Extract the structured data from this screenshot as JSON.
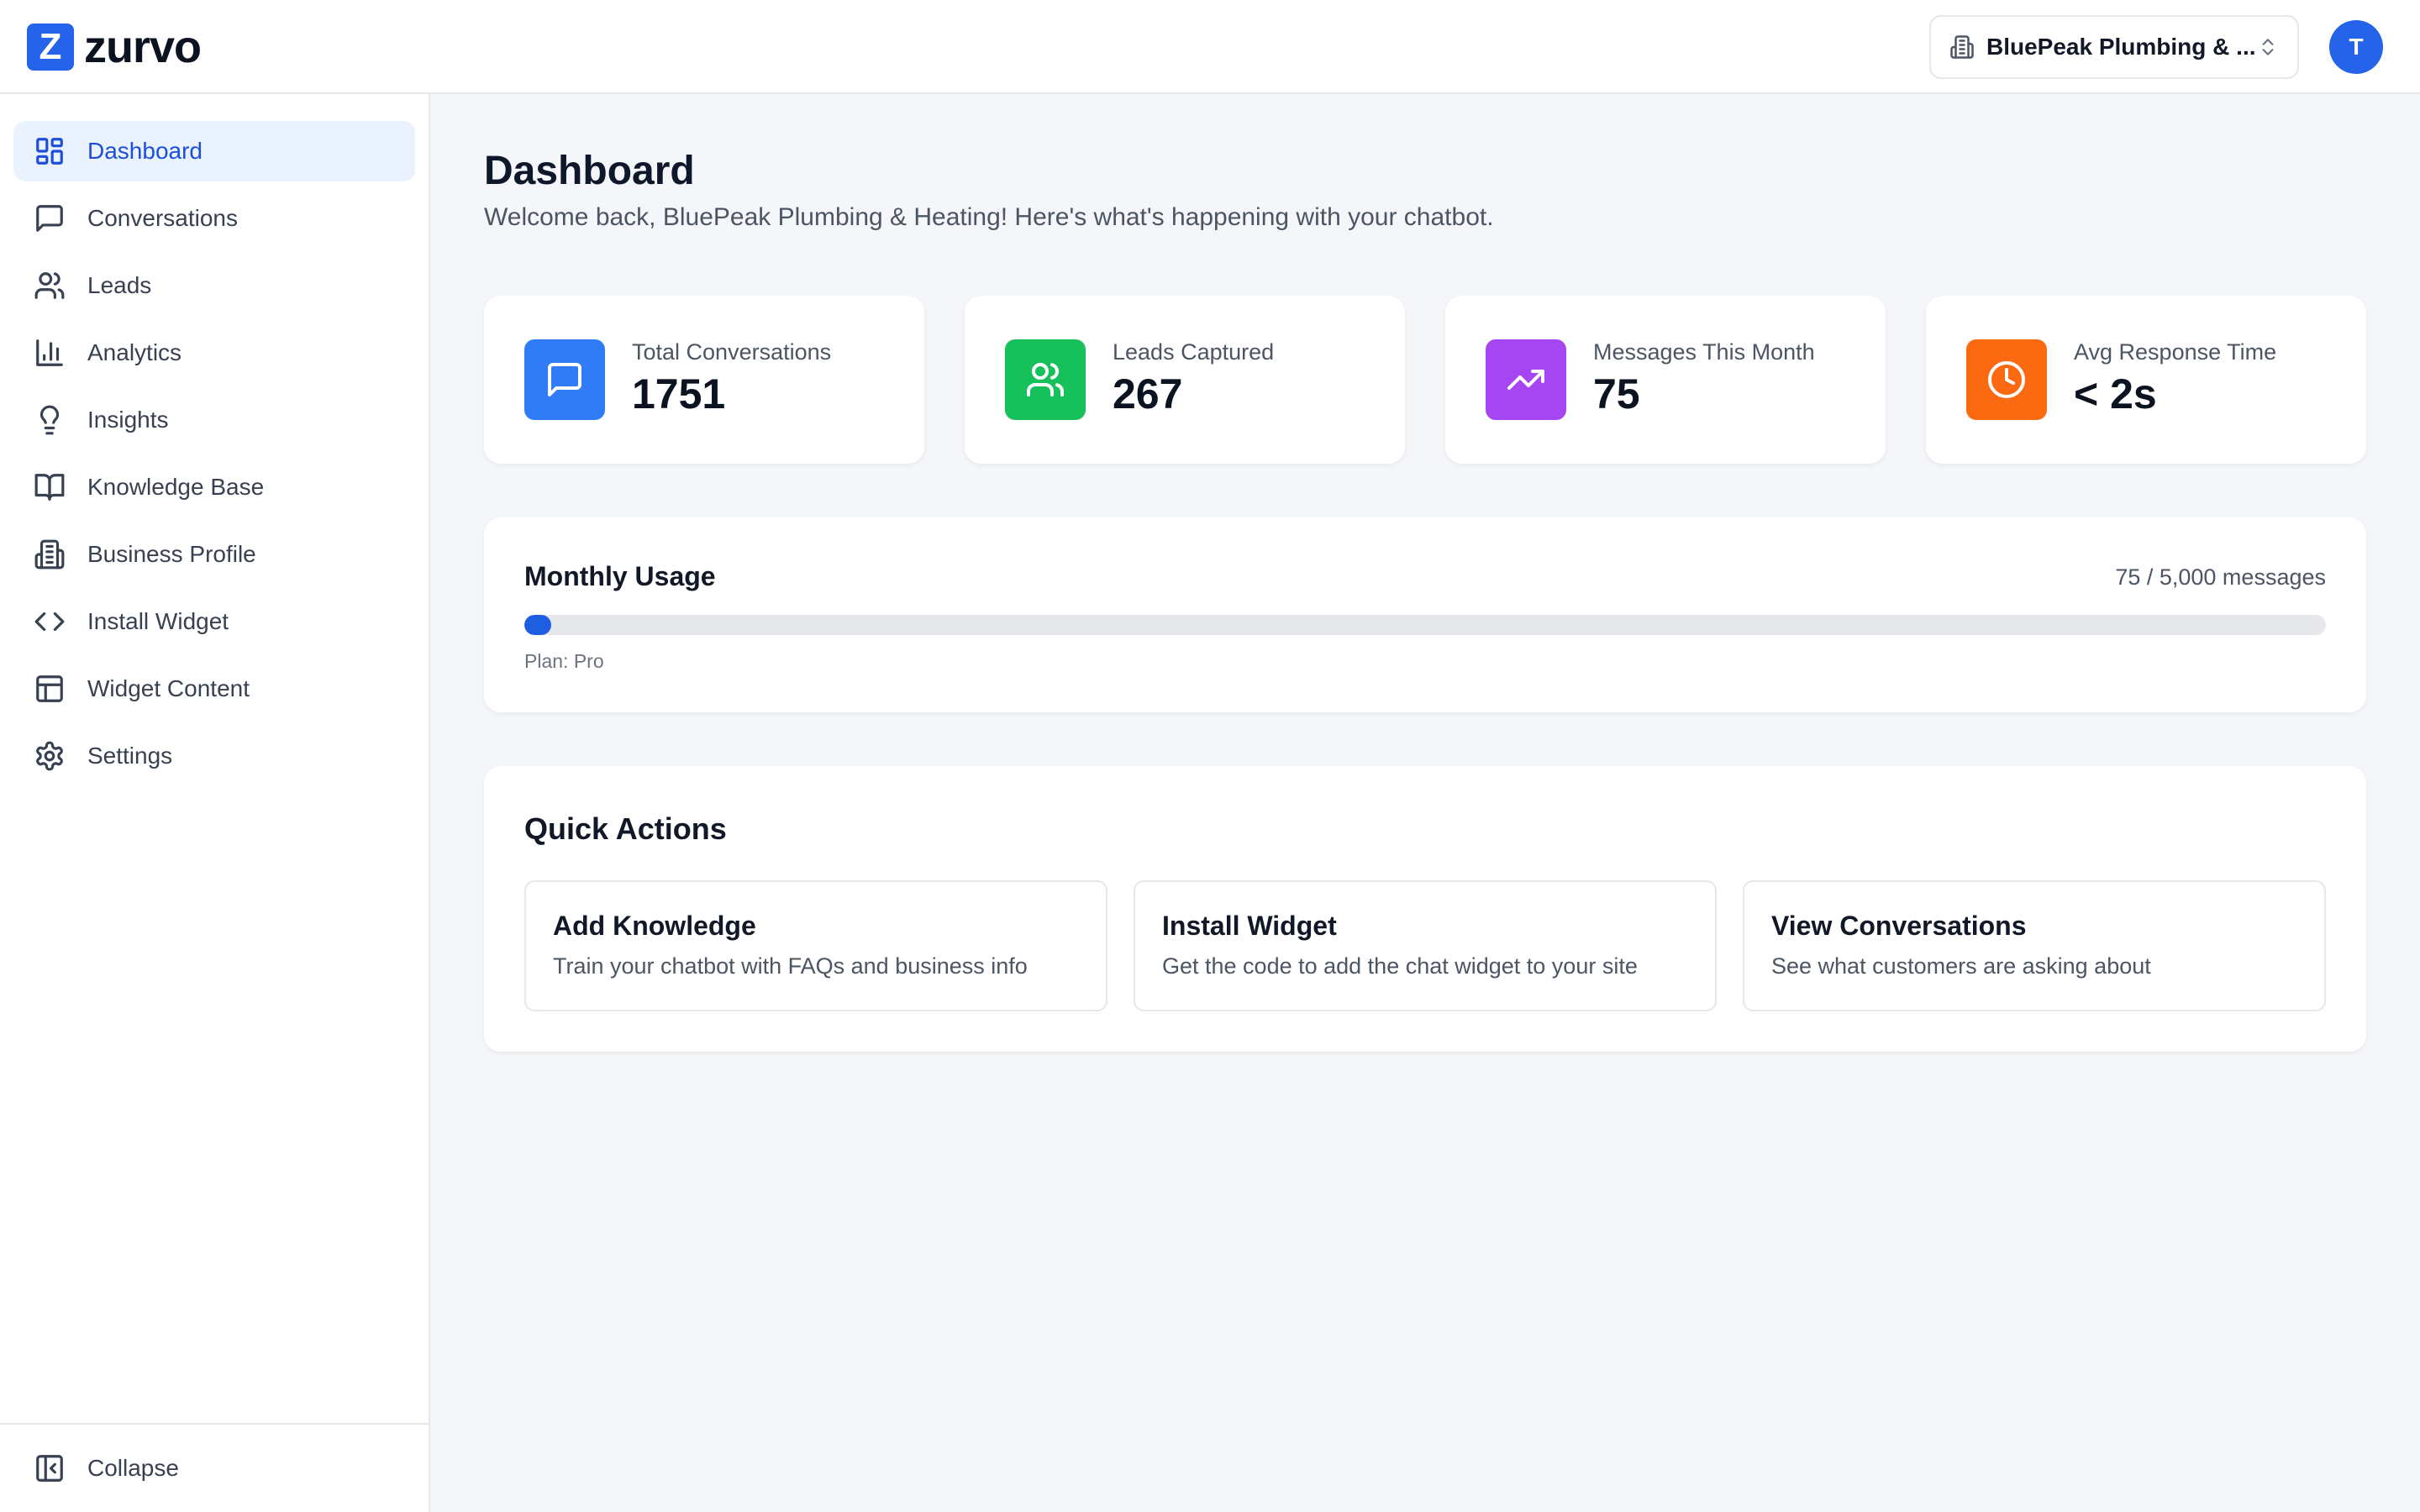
{
  "brand": {
    "mark": "Z",
    "name": "zurvo",
    "accent": "#2563eb"
  },
  "header": {
    "business_select": {
      "value": "BluePeak Plumbing & ...",
      "icon": "building-icon"
    },
    "avatar_initial": "T"
  },
  "sidebar": {
    "items": [
      {
        "label": "Dashboard",
        "icon": "layout-dashboard-icon",
        "active": true
      },
      {
        "label": "Conversations",
        "icon": "message-square-icon"
      },
      {
        "label": "Leads",
        "icon": "users-icon"
      },
      {
        "label": "Analytics",
        "icon": "bar-chart-icon"
      },
      {
        "label": "Insights",
        "icon": "lightbulb-icon"
      },
      {
        "label": "Knowledge Base",
        "icon": "book-open-icon"
      },
      {
        "label": "Business Profile",
        "icon": "building-icon"
      },
      {
        "label": "Install Widget",
        "icon": "code-icon"
      },
      {
        "label": "Widget Content",
        "icon": "layout-icon"
      },
      {
        "label": "Settings",
        "icon": "gear-icon"
      }
    ],
    "collapse_label": "Collapse"
  },
  "main": {
    "title": "Dashboard",
    "subtitle": "Welcome back, BluePeak Plumbing & Heating! Here's what's happening with your chatbot.",
    "stats": [
      {
        "label": "Total Conversations",
        "value": "1751",
        "color": "#2f7cf6",
        "icon": "message-square-icon"
      },
      {
        "label": "Leads Captured",
        "value": "267",
        "color": "#16c05a",
        "icon": "users-icon"
      },
      {
        "label": "Messages This Month",
        "value": "75",
        "color": "#a646f2",
        "icon": "trending-up-icon"
      },
      {
        "label": "Avg Response Time",
        "value": "< 2s",
        "color": "#fb6a10",
        "icon": "clock-icon"
      }
    ],
    "usage": {
      "title": "Monthly Usage",
      "count_text": "75 / 5,000 messages",
      "used": 75,
      "limit": 5000,
      "plan_text": "Plan: Pro"
    },
    "quick_actions": {
      "title": "Quick Actions",
      "items": [
        {
          "title": "Add Knowledge",
          "desc": "Train your chatbot with FAQs and business info"
        },
        {
          "title": "Install Widget",
          "desc": "Get the code to add the chat widget to your site"
        },
        {
          "title": "View Conversations",
          "desc": "See what customers are asking about"
        }
      ]
    }
  }
}
